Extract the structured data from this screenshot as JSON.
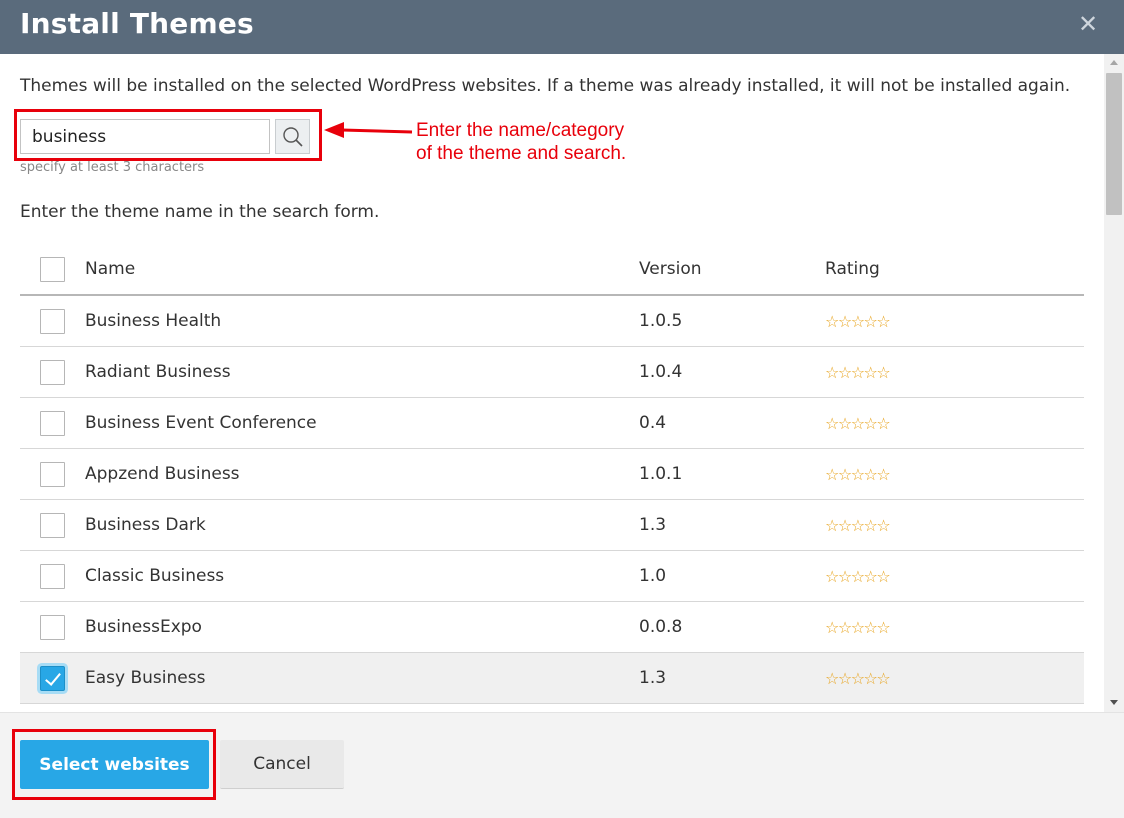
{
  "dialog": {
    "title": "Install Themes",
    "close_icon": "close-icon",
    "description": "Themes will be installed on the selected WordPress websites. If a theme was already installed, it will not be installed again."
  },
  "search": {
    "value": "business",
    "hint": "specify at least 3 characters",
    "icon": "search-icon"
  },
  "annotation": {
    "line1": "Enter the name/category",
    "line2": "of the theme and search."
  },
  "prompt": "Enter the theme name in the search form.",
  "table": {
    "headers": {
      "name": "Name",
      "version": "Version",
      "rating": "Rating"
    },
    "rows": [
      {
        "name": "Business Health",
        "version": "1.0.5",
        "rating": "☆☆☆☆☆",
        "checked": false
      },
      {
        "name": "Radiant Business",
        "version": "1.0.4",
        "rating": "☆☆☆☆☆",
        "checked": false
      },
      {
        "name": "Business Event Conference",
        "version": "0.4",
        "rating": "☆☆☆☆☆",
        "checked": false
      },
      {
        "name": "Appzend Business",
        "version": "1.0.1",
        "rating": "☆☆☆☆☆",
        "checked": false
      },
      {
        "name": "Business Dark",
        "version": "1.3",
        "rating": "☆☆☆☆☆",
        "checked": false
      },
      {
        "name": "Classic Business",
        "version": "1.0",
        "rating": "☆☆☆☆☆",
        "checked": false
      },
      {
        "name": "BusinessExpo",
        "version": "0.0.8",
        "rating": "☆☆☆☆☆",
        "checked": false
      },
      {
        "name": "Easy Business",
        "version": "1.3",
        "rating": "☆☆☆☆☆",
        "checked": true
      }
    ]
  },
  "footer": {
    "primary_label": "Select websites",
    "cancel_label": "Cancel"
  },
  "colors": {
    "titlebar": "#5a6b7c",
    "primary": "#28a7e6",
    "annotation": "#e8000b",
    "star": "#e8a521"
  }
}
